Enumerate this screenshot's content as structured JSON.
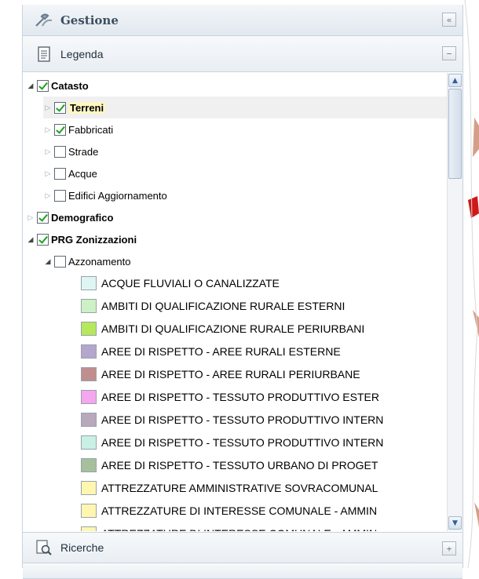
{
  "panel": {
    "title": "Gestione",
    "collapse_glyph": "«",
    "legend_header": "Legenda",
    "legend_tool_glyph": "−",
    "search_header": "Ricerche",
    "search_tool_glyph": "+"
  },
  "tree": {
    "catasto": "Catasto",
    "terreni": "Terreni",
    "fabbricati": "Fabbricati",
    "strade": "Strade",
    "acque": "Acque",
    "edifici": "Edifici Aggiornamento",
    "demografico": "Demografico",
    "prg": "PRG Zonizzazioni",
    "azzonamento": "Azzonamento"
  },
  "legend_items": [
    {
      "label": "ACQUE FLUVIALI O CANALIZZATE",
      "color": "#dff5f4"
    },
    {
      "label": "AMBITI DI QUALIFICAZIONE RURALE ESTERNI",
      "color": "#cdf1c4"
    },
    {
      "label": "AMBITI DI QUALIFICAZIONE RURALE PERIURBANI",
      "color": "#b5e85a"
    },
    {
      "label": "AREE DI RISPETTO - AREE RURALI ESTERNE",
      "color": "#b4a6cc"
    },
    {
      "label": "AREE DI RISPETTO - AREE RURALI PERIURBANE",
      "color": "#c08e8e"
    },
    {
      "label": "AREE DI RISPETTO - TESSUTO PRODUTTIVO ESTER",
      "color": "#f4a6ee"
    },
    {
      "label": "AREE DI RISPETTO - TESSUTO PRODUTTIVO INTERN",
      "color": "#b8a8bc"
    },
    {
      "label": "AREE DI RISPETTO - TESSUTO PRODUTTIVO INTERN",
      "color": "#c9f1e3"
    },
    {
      "label": "AREE DI RISPETTO - TESSUTO URBANO DI PROGET",
      "color": "#a6bf9d"
    },
    {
      "label": "ATTREZZATURE AMMINISTRATIVE SOVRACOMUNAL",
      "color": "#fff7b0"
    },
    {
      "label": "ATTREZZATURE DI INTERESSE COMUNALE - AMMIN",
      "color": "#fff7b0"
    },
    {
      "label": "ATTREZZATURE DI INTERESSE COMUNALE - AMMIN",
      "color": "#fff7b0"
    }
  ]
}
